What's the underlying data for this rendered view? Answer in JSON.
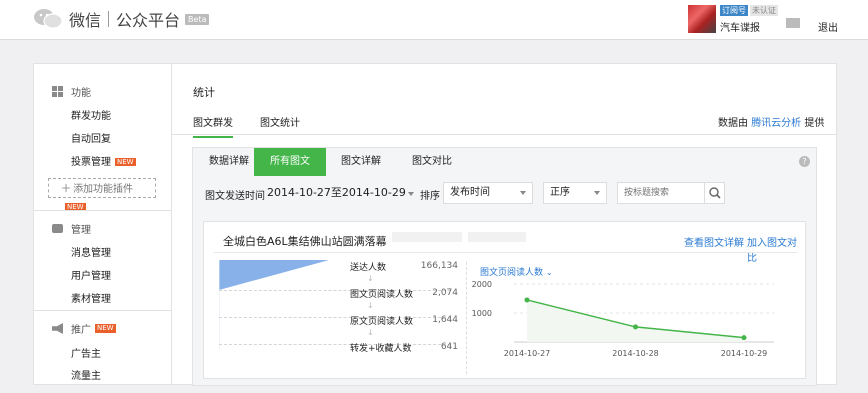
{
  "header": {
    "product": "微信",
    "platform": "公众平台",
    "beta": "Beta",
    "account": {
      "subscription_badge": "订阅号",
      "verify_badge": "未认证",
      "name": "汽车谍报"
    },
    "logout": "退出"
  },
  "sidebar": {
    "sections": [
      {
        "label": "功能",
        "icon": "grid-icon",
        "items": [
          {
            "label": "群发功能"
          },
          {
            "label": "自动回复"
          },
          {
            "label": "投票管理",
            "tag": "NEW"
          }
        ],
        "add_plugin": "添加功能插件",
        "add_plugin_tag": "NEW"
      },
      {
        "label": "管理",
        "icon": "inbox-icon",
        "items": [
          {
            "label": "消息管理"
          },
          {
            "label": "用户管理"
          },
          {
            "label": "素材管理"
          }
        ]
      },
      {
        "label": "推广",
        "icon": "megaphone-icon",
        "tag": "NEW",
        "items": [
          {
            "label": "广告主"
          },
          {
            "label": "流量主"
          }
        ]
      }
    ]
  },
  "main": {
    "title": "统计",
    "tabs": [
      {
        "label": "图文群发",
        "active": true
      },
      {
        "label": "图文统计",
        "active": false
      }
    ],
    "provider": {
      "prefix": "数据由",
      "link": "腾讯云分析",
      "suffix": "提供"
    },
    "subtabs": [
      {
        "label": "数据详解"
      },
      {
        "label": "所有图文",
        "active": true
      },
      {
        "label": "图文详解"
      },
      {
        "label": "图文对比"
      }
    ],
    "filters": {
      "date_label": "图文发送时间",
      "date_range": "2014-10-27至2014-10-29",
      "sort_label": "排序",
      "sort_field": "发布时间",
      "sort_order": "正序",
      "search_placeholder": "按标题搜索"
    },
    "article": {
      "title": "全城白色A6L集结佛山站圆满落幕",
      "detail_link": "查看图文详解",
      "compare_link": "加入图文对比",
      "funnel": [
        {
          "label": "送达人数",
          "value": "166,134"
        },
        {
          "label": "图文页阅读人数",
          "value": "2,074"
        },
        {
          "label": "原文页阅读人数",
          "value": "1,644"
        },
        {
          "label": "转发+收藏人数",
          "value": "641"
        }
      ],
      "metric_selector": "图文页阅读人数"
    }
  },
  "colors": {
    "accent": "#44b549",
    "link": "#2b7bd2",
    "funnel": "#7aa8e6"
  },
  "chart_data": {
    "type": "line",
    "title": "图文页阅读人数",
    "x": [
      "2014-10-27",
      "2014-10-28",
      "2014-10-29"
    ],
    "series": [
      {
        "name": "图文页阅读人数",
        "values": [
          1450,
          520,
          150
        ]
      }
    ],
    "yticks": [
      1000,
      2000
    ],
    "ylim": [
      0,
      2000
    ],
    "grid": true
  }
}
